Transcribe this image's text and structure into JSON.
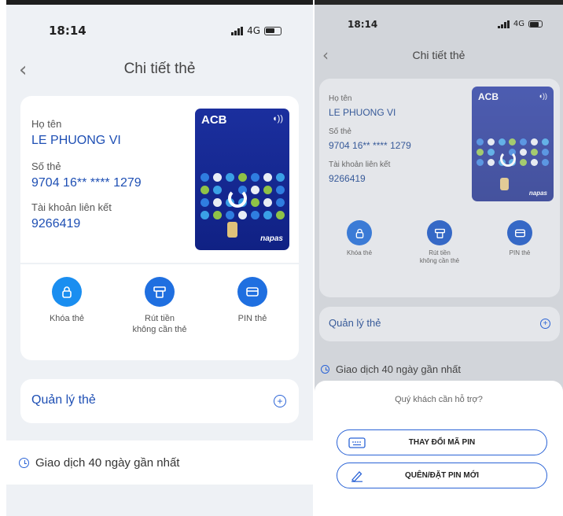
{
  "status": {
    "time": "18:14",
    "network": "4G"
  },
  "header": {
    "back_icon": "chevron-left-icon",
    "title": "Chi tiết thẻ"
  },
  "card_info": {
    "name_label": "Họ tên",
    "name_value": "LE PHUONG VI",
    "number_label": "Số thẻ",
    "number_value": "9704 16** **** 1279",
    "account_label": "Tài khoản liên kết",
    "account_value": "9266419"
  },
  "card_visual": {
    "brand": "ACB",
    "network": "napas"
  },
  "actions": [
    {
      "label": "Khóa thẻ",
      "icon": "lock-icon"
    },
    {
      "label": "Rút tiền\nkhông cần thẻ",
      "icon": "atm-icon"
    },
    {
      "label": "PIN thẻ",
      "icon": "card-icon"
    }
  ],
  "manage": {
    "label": "Quản lý thẻ",
    "icon": "plus-circle-icon"
  },
  "transactions": {
    "label": "Giao dịch 40 ngày gần nhất",
    "icon": "clock-icon"
  },
  "support_sheet": {
    "question": "Quý khách cần hỗ trợ?",
    "change_pin": "THAY ĐỔI MÃ PIN",
    "forgot_pin": "QUÊN/ĐẶT PIN MỚI"
  },
  "colors": {
    "accent": "#1e4fb4",
    "action_blue": "#1577e0",
    "card_blue": "#1b2f9e",
    "app_bg": "#eef1f5"
  }
}
